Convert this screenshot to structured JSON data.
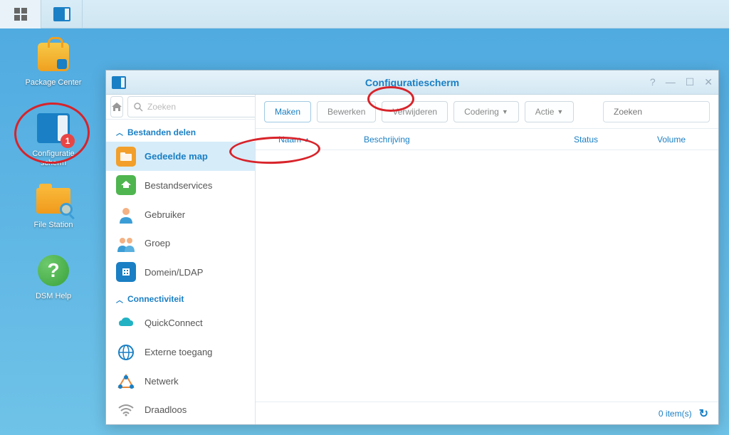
{
  "desktop": {
    "package_center": "Package Center",
    "config_panel": "Configuratie scherm",
    "config_badge": "1",
    "file_station": "File Station",
    "dsm_help": "DSM Help"
  },
  "window": {
    "title": "Configuratiescherm"
  },
  "sidebar": {
    "search_placeholder": "Zoeken",
    "section1": "Bestanden delen",
    "items1": [
      "Gedeelde map",
      "Bestandservices",
      "Gebruiker",
      "Groep",
      "Domein/LDAP"
    ],
    "section2": "Connectiviteit",
    "items2": [
      "QuickConnect",
      "Externe toegang",
      "Netwerk",
      "Draadloos"
    ]
  },
  "toolbar": {
    "maken": "Maken",
    "bewerken": "Bewerken",
    "verwijderen": "Verwijderen",
    "codering": "Codering",
    "actie": "Actie",
    "search_placeholder": "Zoeken"
  },
  "table": {
    "naam": "Naam",
    "beschrijving": "Beschrijving",
    "status": "Status",
    "volume": "Volume"
  },
  "status": {
    "items": "0 item(s)"
  }
}
